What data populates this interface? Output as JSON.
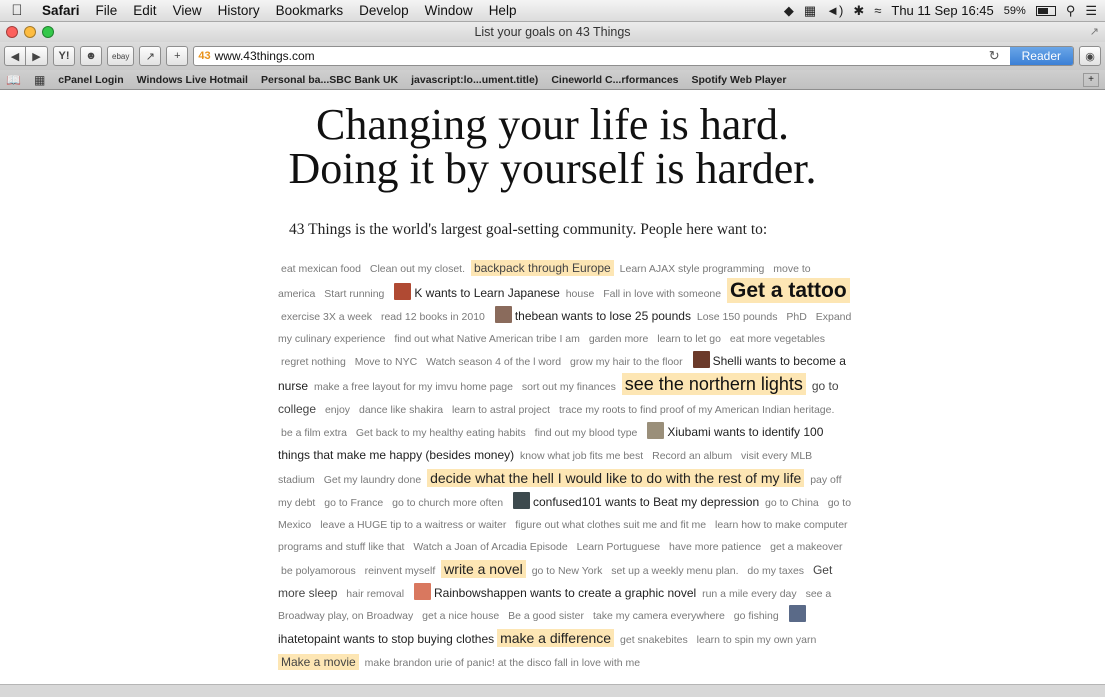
{
  "menubar": {
    "app_name": "Safari",
    "items": [
      "File",
      "Edit",
      "View",
      "History",
      "Bookmarks",
      "Develop",
      "Window",
      "Help"
    ],
    "clock": "Thu 11 Sep  16:45",
    "battery": "59%"
  },
  "window": {
    "title": "List your goals on 43 Things"
  },
  "toolbar": {
    "url": "www.43things.com",
    "favicon_text": "43",
    "ebay_label": "ebay",
    "reader_label": "Reader"
  },
  "bookmarks": {
    "items": [
      "cPanel Login",
      "Windows Live Hotmail",
      "Personal ba...SBC Bank UK",
      "javascript:lo...ument.title)",
      "Cineworld C...rformances",
      "Spotify Web Player"
    ]
  },
  "page": {
    "headline_line1": "Changing your life is hard.",
    "headline_line2": "Doing it by yourself is harder.",
    "intro": "43 Things is the world's largest goal-setting community. People here want to:"
  },
  "cloud": [
    {
      "t": "eat mexican food",
      "s": 1
    },
    {
      "t": "Clean out my closet.",
      "s": 1
    },
    {
      "t": "backpack through Europe",
      "s": 2,
      "hl": true
    },
    {
      "t": "Learn AJAX style programming",
      "s": 1
    },
    {
      "t": "move to america",
      "s": 1
    },
    {
      "t": "Start running",
      "s": 1
    },
    {
      "user": true,
      "t": "K wants to Learn Japanese",
      "av": "#b04a33"
    },
    {
      "t": "house",
      "s": 1
    },
    {
      "t": "Fall in love with someone",
      "s": 1
    },
    {
      "t": "Get a tattoo",
      "s": 5,
      "hl": true
    },
    {
      "t": "exercise 3X a week",
      "s": 1
    },
    {
      "t": "read 12 books in 2010",
      "s": 1
    },
    {
      "user": true,
      "t": "thebean wants to lose 25 pounds",
      "av": "#8a6b5c"
    },
    {
      "t": "Lose 150 pounds",
      "s": 1
    },
    {
      "t": "PhD",
      "s": 1
    },
    {
      "t": "Expand my culinary experience",
      "s": 1
    },
    {
      "t": "find out what Native American tribe I am",
      "s": 1
    },
    {
      "t": "garden more",
      "s": 1
    },
    {
      "t": "learn to let go",
      "s": 1
    },
    {
      "t": "eat more vegetables",
      "s": 1
    },
    {
      "t": "regret nothing",
      "s": 1
    },
    {
      "t": "Move to NYC",
      "s": 1
    },
    {
      "t": "Watch season 4 of the l word",
      "s": 1
    },
    {
      "t": "grow my hair to the floor",
      "s": 1
    },
    {
      "user": true,
      "t": "Shelli wants to become a nurse",
      "av": "#6b3a2a"
    },
    {
      "t": "make a free layout for my imvu home page",
      "s": 1
    },
    {
      "t": "sort out my finances",
      "s": 1
    },
    {
      "t": "see the northern lights",
      "s": 4,
      "hl": true
    },
    {
      "t": "go to college",
      "s": 2
    },
    {
      "t": "enjoy",
      "s": 1
    },
    {
      "t": "dance like shakira",
      "s": 1
    },
    {
      "t": "learn to astral project",
      "s": 1
    },
    {
      "t": "trace my roots to find proof of my American Indian heritage.",
      "s": 1
    },
    {
      "t": "be a film extra",
      "s": 1
    },
    {
      "t": "Get back to my healthy eating habits",
      "s": 1
    },
    {
      "t": "find out my blood type",
      "s": 1
    },
    {
      "user": true,
      "t": "Xiubami wants to identify 100 things that make me happy (besides money)",
      "av": "#9a8f7a"
    },
    {
      "t": "know what job fits me best",
      "s": 1
    },
    {
      "t": "Record an album",
      "s": 1
    },
    {
      "t": "visit every MLB stadium",
      "s": 1
    },
    {
      "t": "Get my laundry done",
      "s": 1
    },
    {
      "t": "decide what the hell I would like to do with the rest of my life",
      "s": 3,
      "hl": true
    },
    {
      "t": "pay off my debt",
      "s": 1
    },
    {
      "t": "go to France",
      "s": 1
    },
    {
      "t": "go to church more often",
      "s": 1
    },
    {
      "user": true,
      "t": "confused101 wants to Beat my depression",
      "av": "#3d4a4e"
    },
    {
      "t": "go to China",
      "s": 1
    },
    {
      "t": "go to Mexico",
      "s": 1
    },
    {
      "t": "leave a HUGE tip to a waitress or waiter",
      "s": 1
    },
    {
      "t": "figure out what clothes suit me and fit me",
      "s": 1
    },
    {
      "t": "learn how to make computer programs and stuff like that",
      "s": 1
    },
    {
      "t": "Watch a Joan of Arcadia Episode",
      "s": 1
    },
    {
      "t": "Learn Portuguese",
      "s": 1
    },
    {
      "t": "have more patience",
      "s": 1
    },
    {
      "t": "get a makeover",
      "s": 1
    },
    {
      "t": "be polyamorous",
      "s": 1
    },
    {
      "t": "reinvent myself",
      "s": 1
    },
    {
      "t": "write a novel",
      "s": 3,
      "hl": true
    },
    {
      "t": "go to New York",
      "s": 1
    },
    {
      "t": "set up a weekly menu plan.",
      "s": 1
    },
    {
      "t": "do my taxes",
      "s": 1
    },
    {
      "t": "Get more sleep",
      "s": 2
    },
    {
      "t": "hair removal",
      "s": 1
    },
    {
      "user": true,
      "t": "Rainbowshappen wants to create a graphic novel",
      "av": "#d9785f"
    },
    {
      "t": "run a mile every day",
      "s": 1
    },
    {
      "t": "see a Broadway play, on Broadway",
      "s": 1
    },
    {
      "t": "get a nice house",
      "s": 1
    },
    {
      "t": "Be a good sister",
      "s": 1
    },
    {
      "t": "take my camera everywhere",
      "s": 1
    },
    {
      "t": "go fishing",
      "s": 1
    },
    {
      "user": true,
      "t": "ihatetopaint wants to stop buying clothes",
      "av": "#5a6a88"
    },
    {
      "t": "make a difference",
      "s": 3,
      "hl": true
    },
    {
      "t": "get snakebites",
      "s": 1
    },
    {
      "t": "learn to spin my own yarn",
      "s": 1
    },
    {
      "t": "Make a movie",
      "s": 2,
      "hl": true
    },
    {
      "t": "make brandon urie of panic! at the disco fall in love with me",
      "s": 1
    }
  ]
}
